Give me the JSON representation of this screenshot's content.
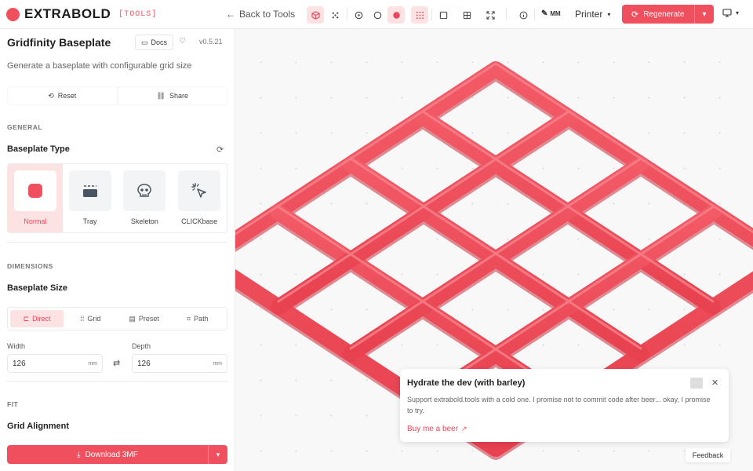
{
  "app": {
    "brand": "EXTRABOLD",
    "tag": "[TOOLS]"
  },
  "topbar": {
    "back_label": "Back to Tools",
    "units_label": "MM",
    "printer_label": "Printer",
    "regenerate_label": "Regenerate",
    "accent_color": "#f04f5e"
  },
  "sidebar": {
    "title": "Gridfinity Baseplate",
    "docs_label": "Docs",
    "version": "v0.5.21",
    "subtitle": "Generate a baseplate with configurable grid size",
    "reset_label": "Reset",
    "share_label": "Share",
    "general_section": "GENERAL",
    "baseplate_type_label": "Baseplate Type",
    "types": [
      {
        "label": "Normal",
        "icon": "rounded-square-icon",
        "selected": true
      },
      {
        "label": "Tray",
        "icon": "tray-icon",
        "selected": false
      },
      {
        "label": "Skeleton",
        "icon": "skull-icon",
        "selected": false
      },
      {
        "label": "CLICKbase",
        "icon": "cursor-click-icon",
        "selected": false
      }
    ],
    "dimensions_section": "DIMENSIONS",
    "baseplate_size_label": "Baseplate Size",
    "size_tabs": [
      {
        "label": "Direct",
        "icon": "direct-icon",
        "active": true
      },
      {
        "label": "Grid",
        "icon": "grid-dots-icon",
        "active": false
      },
      {
        "label": "Preset",
        "icon": "preset-icon",
        "active": false
      },
      {
        "label": "Path",
        "icon": "path-icon",
        "active": false
      }
    ],
    "width_label": "Width",
    "width_value": "126",
    "width_unit": "mm",
    "depth_label": "Depth",
    "depth_value": "126",
    "depth_unit": "mm",
    "fit_section": "FIT",
    "grid_alignment_label": "Grid Alignment",
    "download_label": "Download 3MF"
  },
  "toast": {
    "title": "Hydrate the dev (with barley)",
    "body": "Support extrabold.tools with a cold one. I promise not to commit code after beer... okay, I promise to try.",
    "link_label": "Buy me a beer"
  },
  "feedback_label": "Feedback"
}
